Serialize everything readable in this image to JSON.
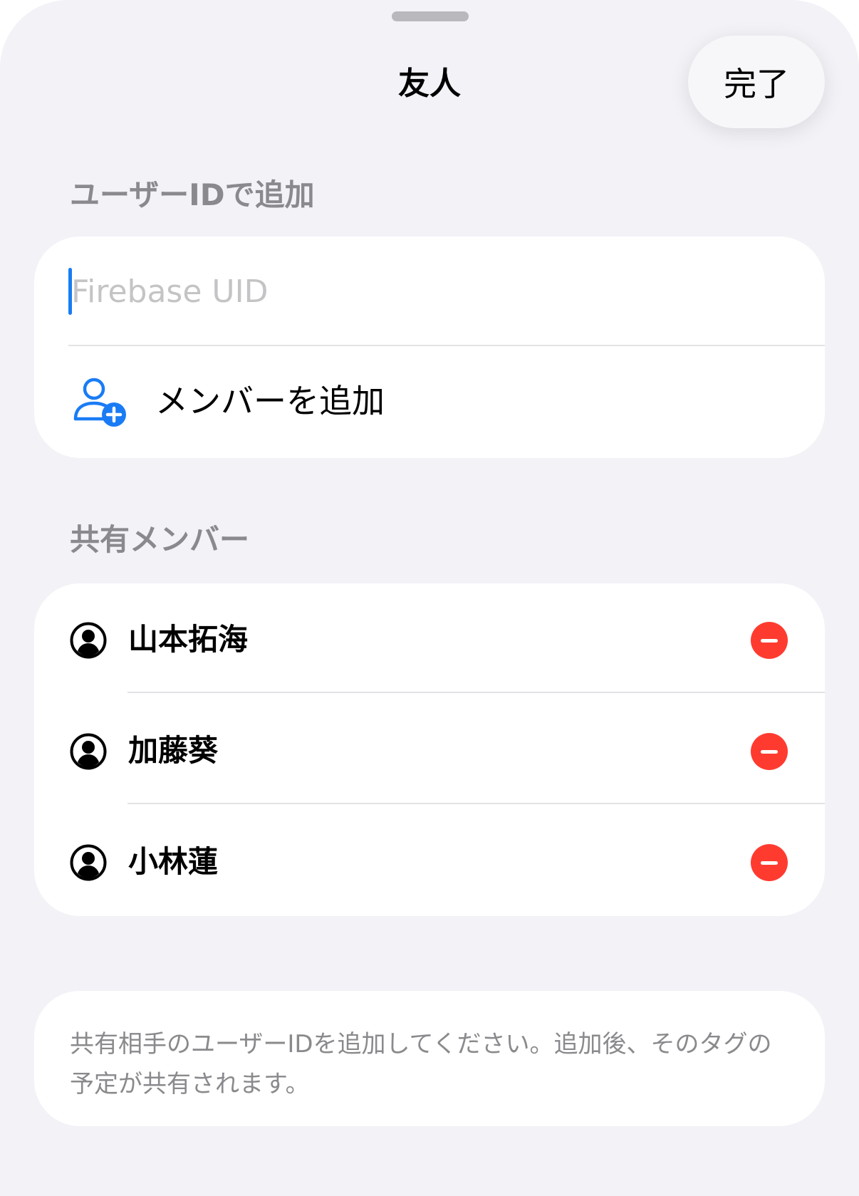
{
  "nav": {
    "title": "友人",
    "done_label": "完了"
  },
  "add_section": {
    "header": "ユーザーIDで追加",
    "input_placeholder": "Firebase UID",
    "input_value": "",
    "add_member_label": "メンバーを追加",
    "add_member_icon": "person-plus-icon"
  },
  "members_section": {
    "header": "共有メンバー",
    "members": [
      {
        "name": "山本拓海",
        "avatar_icon": "person-circle-icon",
        "action_icon": "minus-circle-icon"
      },
      {
        "name": "加藤葵",
        "avatar_icon": "person-circle-icon",
        "action_icon": "minus-circle-icon"
      },
      {
        "name": "小林蓮",
        "avatar_icon": "person-circle-icon",
        "action_icon": "minus-circle-icon"
      }
    ]
  },
  "footer": {
    "note": "共有相手のユーザーIDを追加してください。追加後、そのタグの予定が共有されます。"
  },
  "colors": {
    "accent": "#1a7cf5",
    "destructive": "#ff3b30",
    "background": "#f2f2f7",
    "secondary_text": "#8a8a8e"
  }
}
